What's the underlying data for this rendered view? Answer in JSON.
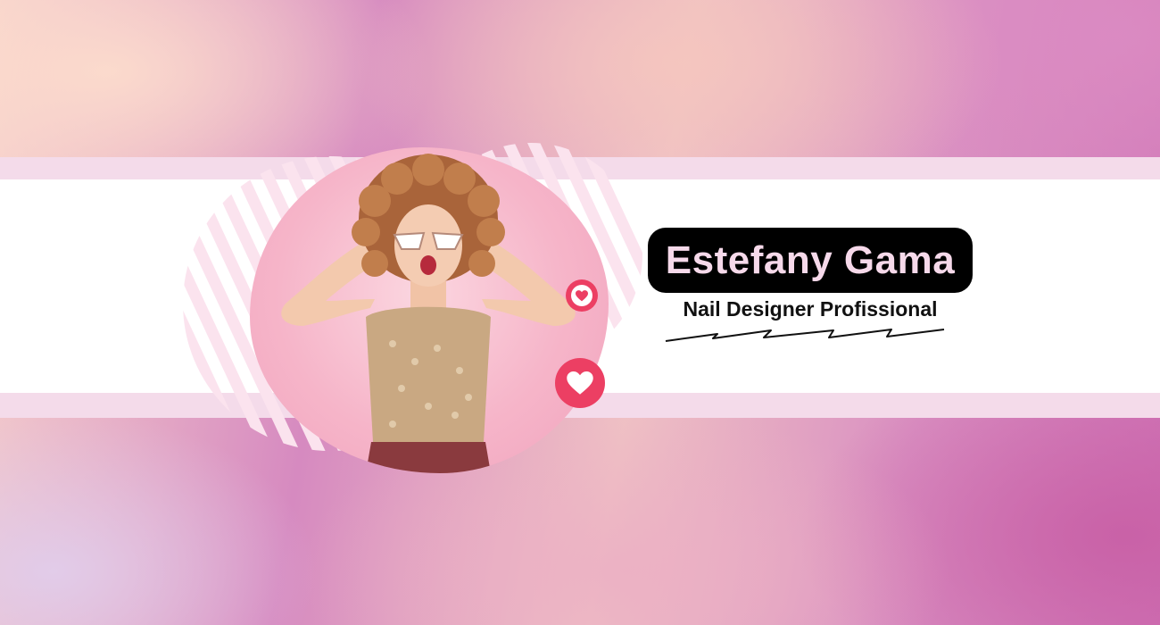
{
  "banner": {
    "name": "Estefany Gama",
    "title": "Nail Designer Profissional"
  },
  "icons": {
    "heart_small": "heart-icon",
    "heart_large": "heart-icon"
  },
  "colors": {
    "accent": "#ec3f63",
    "pill_background": "#000000",
    "name_text": "#f6d9ea",
    "band_light": "#f4dbea"
  }
}
